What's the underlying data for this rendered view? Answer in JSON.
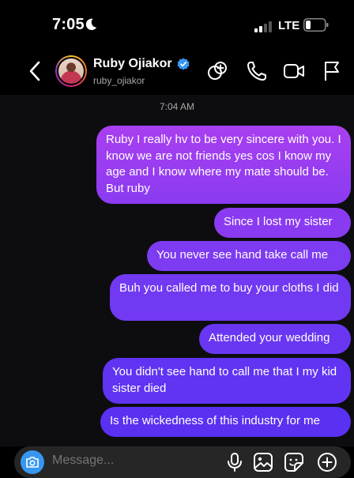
{
  "status": {
    "time": "7:05",
    "network": "LTE"
  },
  "header": {
    "name": "Ruby Ojiakor",
    "username": "ruby_ojiakor"
  },
  "chat": {
    "timestamp": "7:04 AM",
    "messages": [
      "Ruby I really hv to be very sincere with you. I know we are not friends yes cos I know my age and I know where my mate should be. But ruby",
      "Since I lost my sister",
      "You never see hand take call me",
      "Buh you called me to buy your cloths I did",
      "Attended your wedding",
      "You didn't see hand to call me that I my kid sister died",
      "Is the wickedness of this industry for me"
    ]
  },
  "composer": {
    "placeholder": "Message..."
  },
  "colors": {
    "bubble_top": "#9b3df0",
    "bubble_bottom": "#5b2df0",
    "accent": "#3797f0"
  }
}
